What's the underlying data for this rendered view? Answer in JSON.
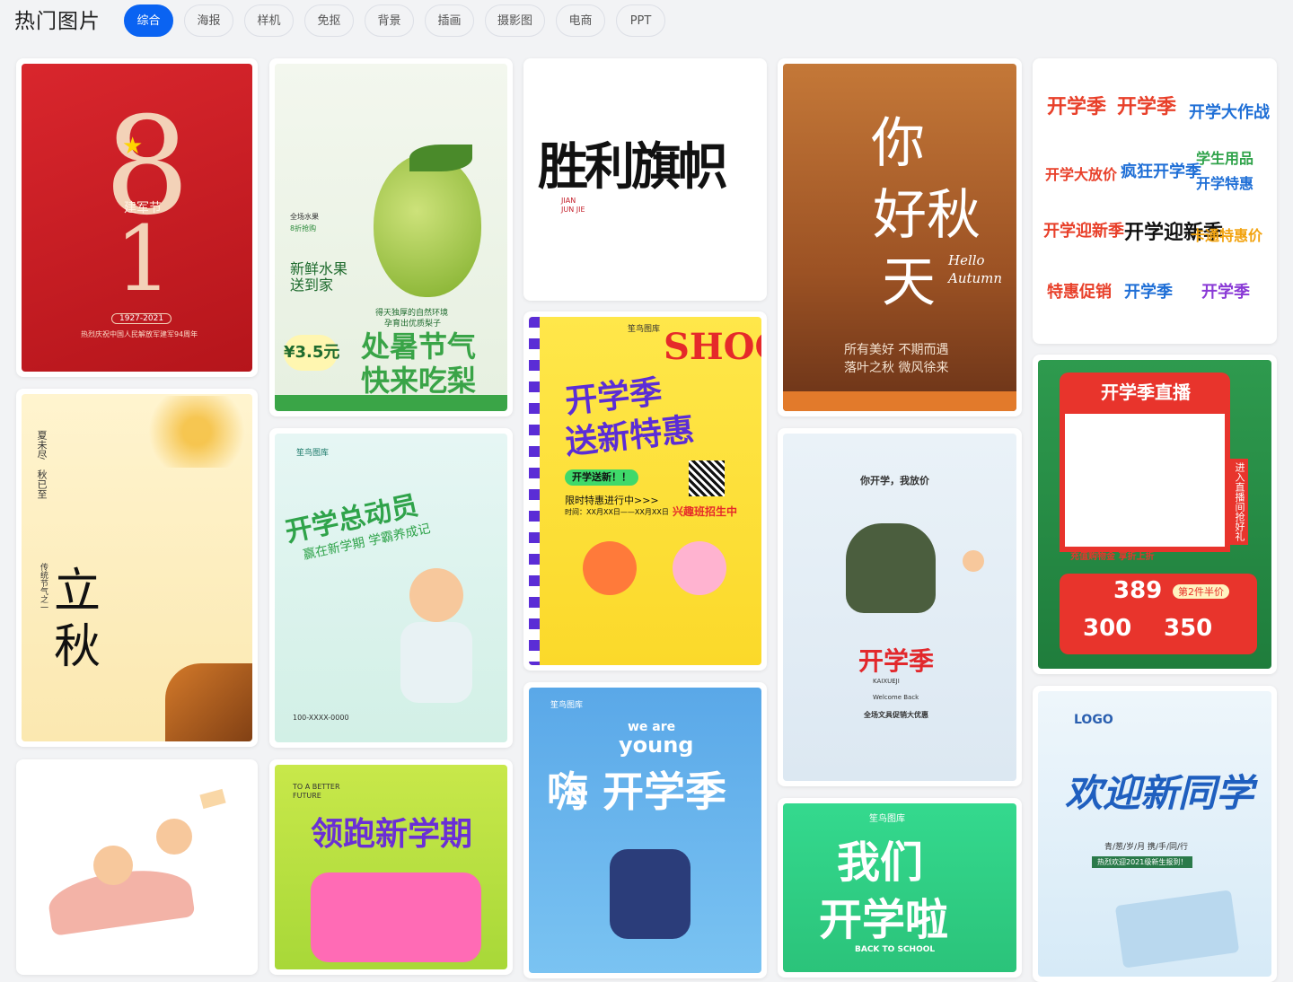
{
  "header": {
    "title": "热门图片",
    "tabs": [
      "综合",
      "海报",
      "样机",
      "免抠",
      "背景",
      "插画",
      "摄影图",
      "电商",
      "PPT"
    ],
    "active_tab": "综合",
    "accent_color": "#0a63f2"
  },
  "cards": {
    "c1": {
      "big": "1",
      "label": "建军节",
      "years": "1927-2021",
      "caption": "热烈庆祝中国人民解放军建军94周年"
    },
    "c2": {
      "t1": "新鲜水果",
      "t2": "送到家",
      "price": "¥3.5元",
      "unit": "斤",
      "h1": "处暑节气",
      "h2": "快来吃梨",
      "note1": "得天独厚的自然环境",
      "note2": "孕育出优质梨子",
      "tag": "全场水果",
      "tag2": "8折抢购"
    },
    "c3": {
      "title": "胜利旗帜",
      "sub1": "JIAN",
      "sub2": "JUN JIE"
    },
    "c4": {
      "big1": "你",
      "big2": "好秋",
      "big3": "天",
      "hello": "Hello",
      "autumn": "Autumn",
      "line1": "所有美好 不期而遇",
      "line2": "落叶之秋 微风徐来"
    },
    "c5": {
      "w1": "开学季",
      "w2": "开学季",
      "w3": "开学大作战",
      "w4": "开学大放价",
      "w5": "疯狂开学季",
      "w6": "学生用品",
      "w7": "开学特惠",
      "w8": "开学迎新季",
      "w9": "卡通特惠价",
      "w10": "特惠促销",
      "w11": "开学季",
      "w12": "开学季"
    },
    "c6": {
      "big1": "立",
      "big2": "秋",
      "side1": "夏未尽",
      "side2": "秋已至",
      "small": "传统节气之一"
    },
    "c7": {
      "brand": "笙鸟图库",
      "title": "开学总动员",
      "sub": "赢在新学期 学霸养成记",
      "phone": "100-XXXX-0000"
    },
    "c8": {
      "brand": "笙鸟图库",
      "shool": "SHOOL",
      "t1": "开学季",
      "t2": "送新特惠",
      "tag": "开学送新！！",
      "line1": "限时特惠进行中>>>",
      "line2": "时间：XX月XX日——XX月XX日",
      "line3": "兴趣班招生中"
    },
    "c9": {
      "title": "你开学，我放价",
      "big": "开学季",
      "sub": "KAIXUEJI",
      "welcome": "Welcome Back",
      "offer": "全场文具促销大优惠"
    },
    "c10": {
      "title": "开学季直播",
      "side": "进入直播间抢好礼",
      "tag": "充值购物金 享折上折",
      "n1": "389",
      "n1tag": "第2件半价",
      "n2": "300",
      "n3": "350"
    },
    "c11": {
      "t1": "TO A BETTER",
      "t2": "FUTURE",
      "title": "领跑新学期"
    },
    "c12": {
      "brand": "笙鸟图库",
      "we": "we are",
      "young": "young",
      "title": "嗨 开学季"
    },
    "c13": {
      "brand": "笙鸟图库",
      "t1": "我们",
      "t2": "开学啦",
      "back": "BACK TO SCHOOL"
    },
    "c14": {
      "logo": "LOGO",
      "title": "欢迎新同学",
      "sub": "青/葱/岁/月  携/手/同/行",
      "banner": "热烈欢迎2021级新生报到！"
    }
  }
}
